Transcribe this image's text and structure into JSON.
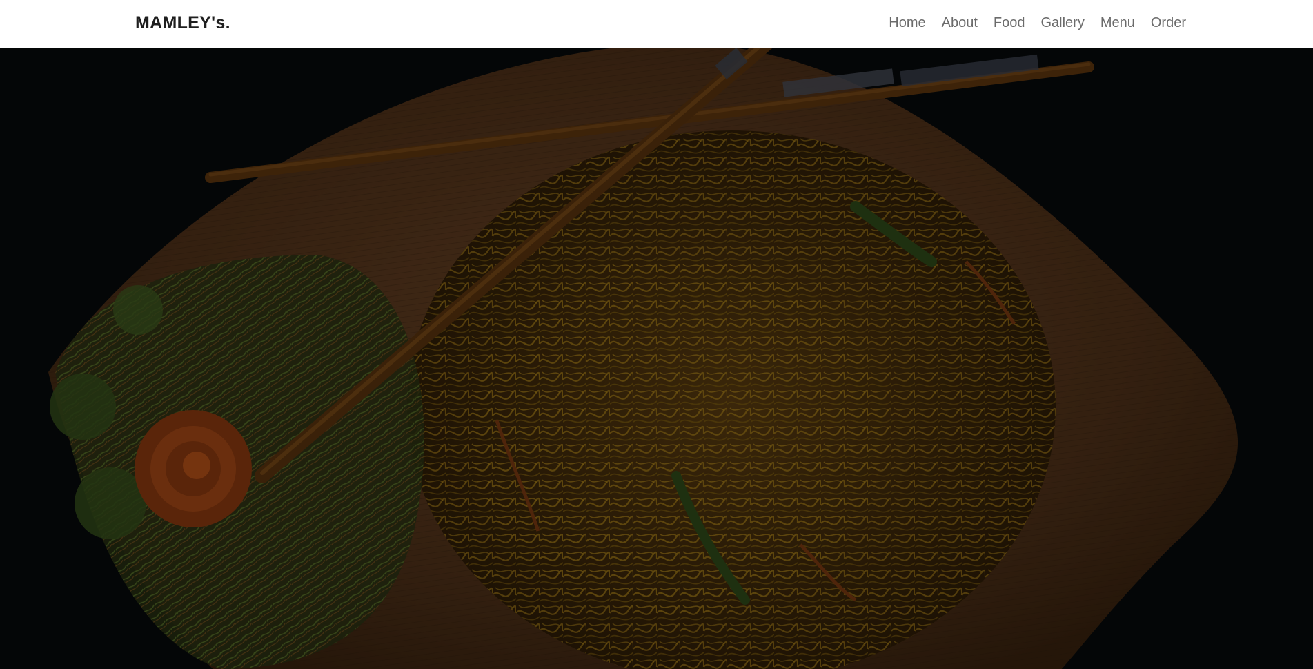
{
  "header": {
    "brand": "MAMLEY's.",
    "nav": [
      {
        "label": "Home"
      },
      {
        "label": "About"
      },
      {
        "label": "Food"
      },
      {
        "label": "Gallery"
      },
      {
        "label": "Menu"
      },
      {
        "label": "Order"
      }
    ]
  },
  "hero": {
    "image": "noodles-on-wooden-plate-with-chopsticks"
  },
  "colors": {
    "nav_bg": "#ffffff",
    "brand_text": "#1f1f1f",
    "nav_link": "#6b6b6b",
    "hero_bg": "#070a0c"
  }
}
